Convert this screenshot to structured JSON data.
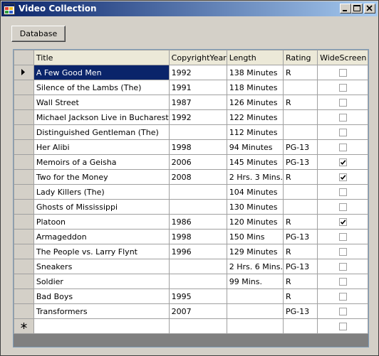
{
  "window": {
    "title": "Video Collection"
  },
  "toolbar": {
    "database_label": "Database"
  },
  "grid": {
    "columns": [
      "Title",
      "CopyrightYear",
      "Length",
      "Rating",
      "WideScreen"
    ],
    "current_row": 0,
    "rows": [
      {
        "title": "A Few Good Men",
        "year": "1992",
        "length": "138 Minutes",
        "rating": "R",
        "widescreen": false
      },
      {
        "title": "Silence of the Lambs (The)",
        "year": "1991",
        "length": "118 Minutes",
        "rating": "",
        "widescreen": false
      },
      {
        "title": "Wall Street",
        "year": "1987",
        "length": "126 Minutes",
        "rating": "R",
        "widescreen": false
      },
      {
        "title": "Michael Jackson Live in Bucharest",
        "year": "1992",
        "length": "122 Minutes",
        "rating": "",
        "widescreen": false
      },
      {
        "title": "Distinguished Gentleman (The)",
        "year": "",
        "length": "112 Minutes",
        "rating": "",
        "widescreen": false
      },
      {
        "title": "Her Alibi",
        "year": "1998",
        "length": "94 Minutes",
        "rating": "PG-13",
        "widescreen": false
      },
      {
        "title": "Memoirs of a Geisha",
        "year": "2006",
        "length": "145 Minutes",
        "rating": "PG-13",
        "widescreen": true
      },
      {
        "title": "Two for the Money",
        "year": "2008",
        "length": "2 Hrs. 3 Mins.",
        "rating": "R",
        "widescreen": true
      },
      {
        "title": "Lady Killers (The)",
        "year": "",
        "length": "104 Minutes",
        "rating": "",
        "widescreen": false
      },
      {
        "title": "Ghosts of Mississippi",
        "year": "",
        "length": "130 Minutes",
        "rating": "",
        "widescreen": false
      },
      {
        "title": "Platoon",
        "year": "1986",
        "length": "120 Minutes",
        "rating": "R",
        "widescreen": true
      },
      {
        "title": "Armageddon",
        "year": "1998",
        "length": "150 Mins",
        "rating": "PG-13",
        "widescreen": false
      },
      {
        "title": "The People vs. Larry Flynt",
        "year": "1996",
        "length": "129 Minutes",
        "rating": "R",
        "widescreen": false
      },
      {
        "title": "Sneakers",
        "year": "",
        "length": "2 Hrs. 6 Mins.",
        "rating": "PG-13",
        "widescreen": false
      },
      {
        "title": "Soldier",
        "year": "",
        "length": "99 Mins.",
        "rating": "R",
        "widescreen": false
      },
      {
        "title": "Bad Boys",
        "year": "1995",
        "length": "",
        "rating": "R",
        "widescreen": false
      },
      {
        "title": "Transformers",
        "year": "2007",
        "length": "",
        "rating": "PG-13",
        "widescreen": false
      }
    ],
    "new_row": {
      "title": "",
      "year": "",
      "length": "",
      "rating": "",
      "widescreen": false
    }
  },
  "colors": {
    "selection": "#0a246a",
    "title_bar": "#0a246a",
    "window_bg": "#d4d0c8"
  },
  "icons": {
    "app": "app-icon",
    "current_row": "row-pointer-icon",
    "new_row": "new-row-asterisk-icon"
  }
}
